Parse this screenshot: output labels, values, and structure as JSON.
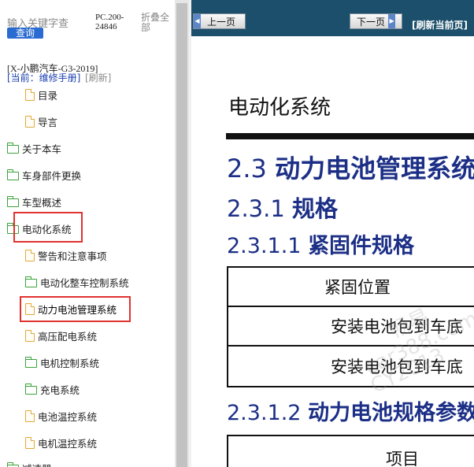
{
  "sidebar": {
    "search_placeholder": "输入关键字查",
    "search_button": "查询",
    "pc_code": "PC.200-24846",
    "collapse_all": "折叠全部",
    "model": "[X-小鹏汽车-G3-2019]",
    "current": "[当前：维修手册]",
    "refresh": "[刷新]",
    "items": [
      {
        "label": "目录",
        "icon": "document-icon"
      },
      {
        "label": "导言",
        "icon": "document-icon"
      },
      {
        "label": "关于本车",
        "icon": "folder-icon"
      },
      {
        "label": "车身部件更换",
        "icon": "folder-icon"
      },
      {
        "label": "车型概述",
        "icon": "folder-icon"
      },
      {
        "label": "电动化系统",
        "icon": "folder-open-icon"
      },
      {
        "label": "警告和注意事项",
        "icon": "document-icon"
      },
      {
        "label": "电动化整车控制系统",
        "icon": "folder-icon"
      },
      {
        "label": "动力电池管理系统",
        "icon": "document-icon"
      },
      {
        "label": "高压配电系统",
        "icon": "document-icon"
      },
      {
        "label": "电机控制系统",
        "icon": "folder-icon"
      },
      {
        "label": "充电系统",
        "icon": "folder-icon"
      },
      {
        "label": "电池温控系统",
        "icon": "document-icon"
      },
      {
        "label": "电机温控系统",
        "icon": "document-icon"
      },
      {
        "label": "减速器",
        "icon": "folder-icon"
      }
    ]
  },
  "toolbar": {
    "prev_label": "上一页",
    "next_label": "下一页",
    "refresh_label": "[刷新当前页]"
  },
  "document": {
    "title": "电动化系统",
    "h2_num": "2.3",
    "h2_text": "动力电池管理系统",
    "h3_num": "2.3.1",
    "h3_text": "规格",
    "h4_num": "2.3.1.1",
    "h4_text": "紧固件规格",
    "table1": [
      "紧固位置",
      "安装电池包到车底",
      "安装电池包到车底"
    ],
    "h4b_num": "2.3.1.2",
    "h4b_text": "动力电池规格参数",
    "table2": [
      "项目"
    ],
    "watermark": [
      "畅易",
      "car388.com",
      "CY2013"
    ]
  },
  "colors": {
    "toolbar_bg": "#1c4f6b",
    "heading": "#1c2f86",
    "highlight": "#e0322f",
    "search_button": "#2a6bd1"
  }
}
